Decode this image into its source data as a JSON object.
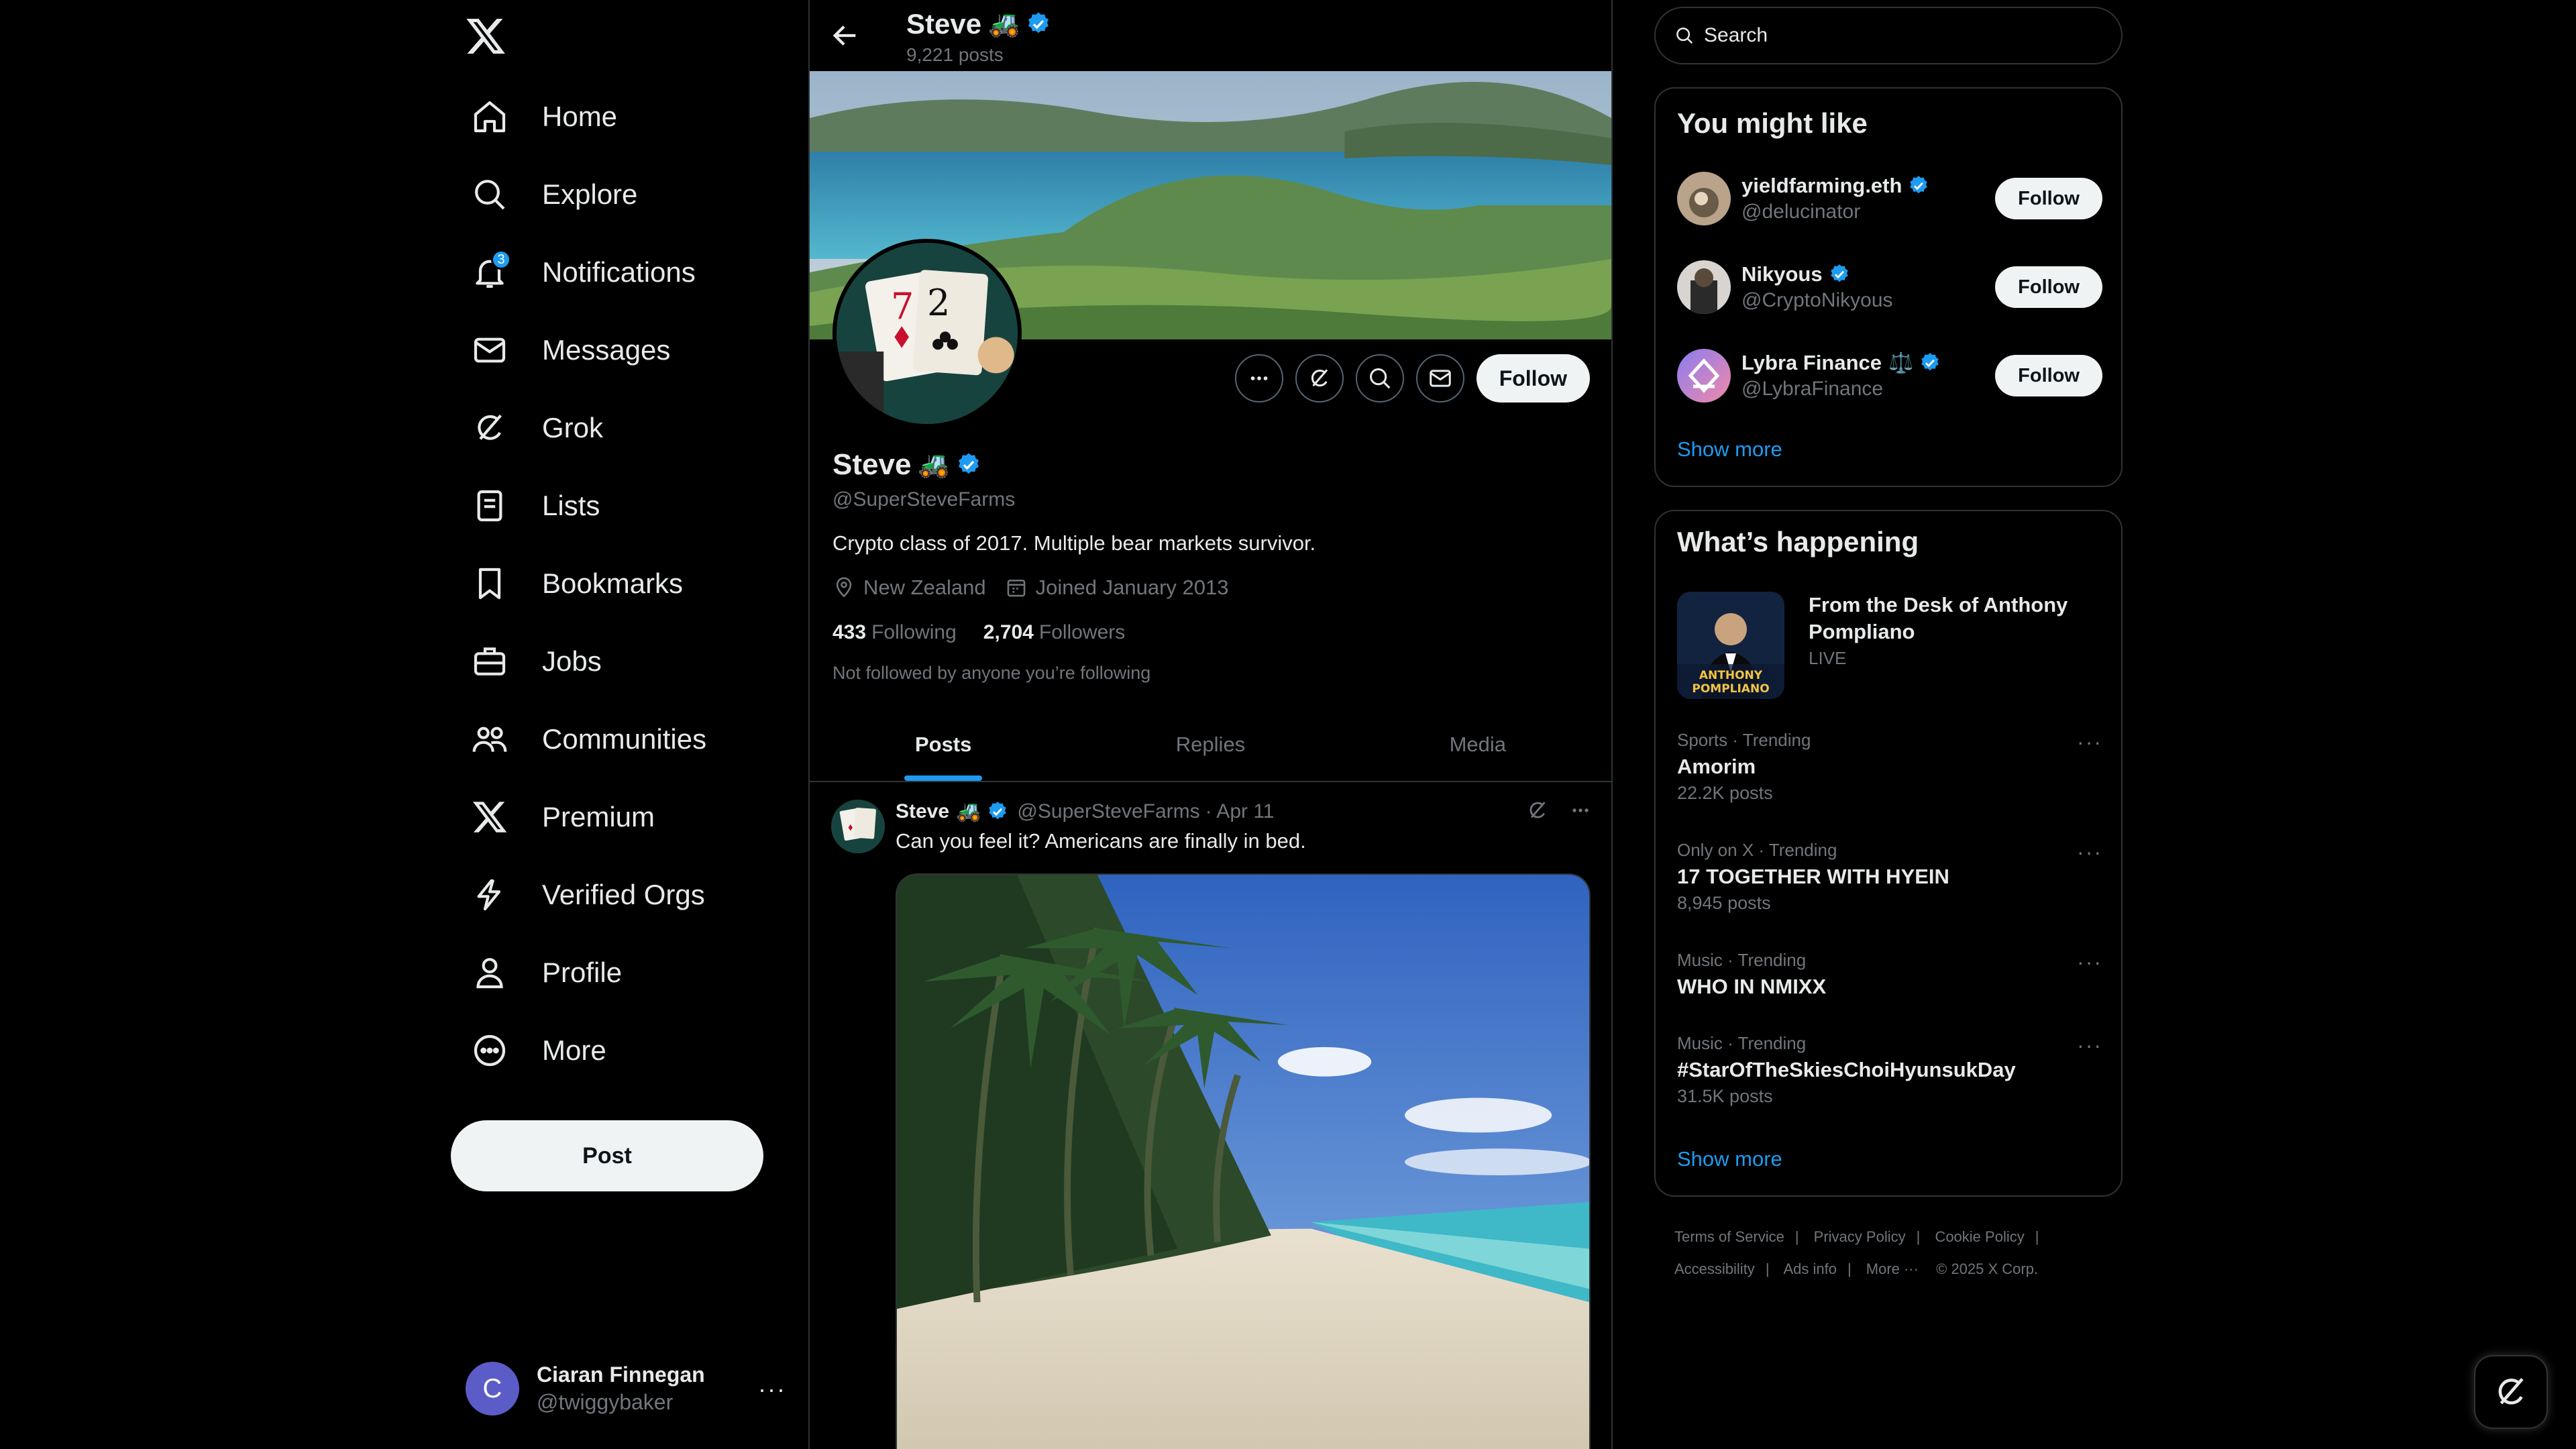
{
  "nav": {
    "items": [
      {
        "label": "Home",
        "icon": "home-icon"
      },
      {
        "label": "Explore",
        "icon": "search-icon"
      },
      {
        "label": "Notifications",
        "icon": "bell-icon",
        "badge": "3"
      },
      {
        "label": "Messages",
        "icon": "envelope-icon"
      },
      {
        "label": "Grok",
        "icon": "grok-icon"
      },
      {
        "label": "Lists",
        "icon": "list-icon"
      },
      {
        "label": "Bookmarks",
        "icon": "bookmark-icon"
      },
      {
        "label": "Jobs",
        "icon": "briefcase-icon"
      },
      {
        "label": "Communities",
        "icon": "people-icon"
      },
      {
        "label": "Premium",
        "icon": "x-logo-icon"
      },
      {
        "label": "Verified Orgs",
        "icon": "lightning-icon"
      },
      {
        "label": "Profile",
        "icon": "person-icon"
      },
      {
        "label": "More",
        "icon": "more-circle-icon"
      }
    ],
    "post_label": "Post",
    "account": {
      "initial": "C",
      "name": "Ciaran Finnegan",
      "handle": "@twiggybaker"
    }
  },
  "header": {
    "name": "Steve",
    "emoji": "🚜",
    "post_count": "9,221 posts"
  },
  "profile": {
    "name": "Steve",
    "emoji": "🚜",
    "handle": "@SuperSteveFarms",
    "bio": "Crypto class of 2017. Multiple bear markets survivor.",
    "location": "New Zealand",
    "joined": "Joined January 2013",
    "following_count": "433",
    "following_label": "Following",
    "followers_count": "2,704",
    "followers_label": "Followers",
    "not_followed": "Not followed by anyone you’re following",
    "follow_label": "Follow"
  },
  "tabs": [
    {
      "label": "Posts",
      "active": true
    },
    {
      "label": "Replies",
      "active": false
    },
    {
      "label": "Media",
      "active": false
    }
  ],
  "tweet": {
    "name": "Steve",
    "emoji": "🚜",
    "handle": "@SuperSteveFarms",
    "date": "· Apr 11",
    "text": "Can you feel it? Americans are finally in bed."
  },
  "search": {
    "placeholder": "Search"
  },
  "you_might_like": {
    "title": "You might like",
    "items": [
      {
        "name": "yieldfarming.eth",
        "emoji": "",
        "handle": "@delucinator",
        "follow": "Follow"
      },
      {
        "name": "Nikyous",
        "emoji": "",
        "handle": "@CryptoNikyous",
        "follow": "Follow"
      },
      {
        "name": "Lybra Finance",
        "emoji": "⚖️",
        "handle": "@LybraFinance",
        "follow": "Follow"
      }
    ],
    "show_more": "Show more"
  },
  "whats_happening": {
    "title": "What’s happening",
    "featured": {
      "title": "From the Desk of Anthony Pompliano",
      "status": "LIVE",
      "image_text_1": "ANTHONY",
      "image_text_2": "POMPLIANO"
    },
    "trends": [
      {
        "meta": "Sports · Trending",
        "name": "Amorim",
        "count": "22.2K posts"
      },
      {
        "meta": "Only on X · Trending",
        "name": "17 TOGETHER WITH HYEIN",
        "count": "8,945 posts"
      },
      {
        "meta": "Music · Trending",
        "name": "WHO IN NMIXX",
        "count": ""
      },
      {
        "meta": "Music · Trending",
        "name": "#StarOfTheSkiesChoiHyunsukDay",
        "count": "31.5K posts"
      }
    ],
    "show_more": "Show more"
  },
  "footer": {
    "links": [
      "Terms of Service",
      "Privacy Policy",
      "Cookie Policy",
      "Accessibility",
      "Ads info",
      "More ···"
    ],
    "copyright": "© 2025 X Corp."
  },
  "colors": {
    "accent": "#1d9bf0",
    "background": "#000000",
    "text": "#e7e9ea",
    "muted": "#71767b",
    "border": "#2f3336"
  }
}
